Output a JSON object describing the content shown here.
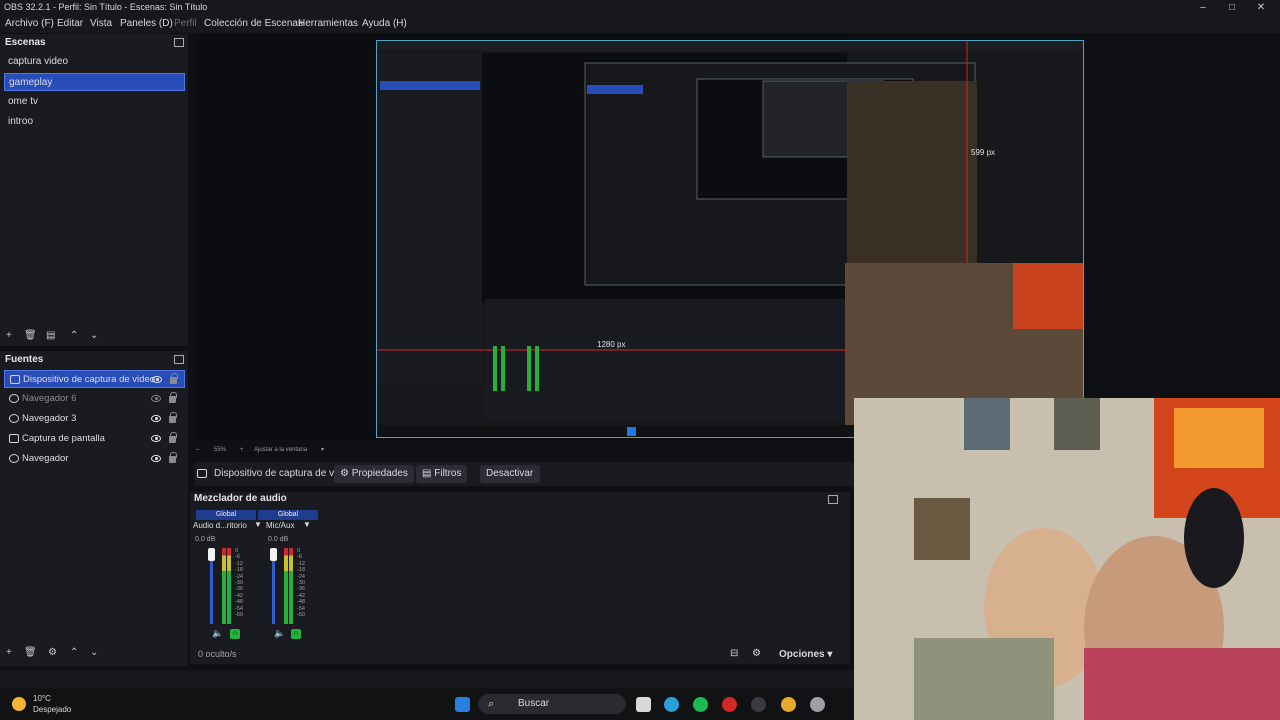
{
  "window": {
    "title": "OBS 32.2.1 - Perfil: Sin Título - Escenas: Sin Título"
  },
  "menu": [
    {
      "label": "Archivo (F)",
      "dim": false
    },
    {
      "label": "Editar",
      "dim": false
    },
    {
      "label": "Vista",
      "dim": false
    },
    {
      "label": "Paneles (D)",
      "dim": false
    },
    {
      "label": "Perfil",
      "dim": true
    },
    {
      "label": "Colección de Escenas",
      "dim": false
    },
    {
      "label": "Herramientas",
      "dim": false
    },
    {
      "label": "Ayuda (H)",
      "dim": false
    }
  ],
  "scenes": {
    "title": "Escenas",
    "items": [
      {
        "label": "captura video",
        "selected": false
      },
      {
        "label": "gameplay",
        "selected": true
      },
      {
        "label": "ome tv",
        "selected": false
      },
      {
        "label": "introo",
        "selected": false
      }
    ]
  },
  "sources": {
    "title": "Fuentes",
    "items": [
      {
        "label": "Dispositivo de captura de video",
        "selected": true,
        "dim": false
      },
      {
        "label": "Navegador 6",
        "selected": false,
        "dim": true
      },
      {
        "label": "Navegador 3",
        "selected": false,
        "dim": false
      },
      {
        "label": "Captura de pantalla",
        "selected": false,
        "dim": false
      },
      {
        "label": "Navegador",
        "selected": false,
        "dim": false
      }
    ]
  },
  "preview": {
    "measure_h": "1280 px",
    "measure_v": "599 px",
    "zoom": "55%",
    "fit": "Ajustar a la ventana"
  },
  "context_bar": {
    "source": "Dispositivo de captura de v",
    "properties": "Propiedades",
    "filters": "Filtros",
    "deactivate": "Desactivar"
  },
  "mixer": {
    "title": "Mezclador de audio",
    "channels": [
      {
        "scope": "Global",
        "name": "Audio d...ritorio",
        "db": "0.0 dB",
        "level": 0.7
      },
      {
        "scope": "Global",
        "name": "Mic/Aux",
        "db": "0.0 dB",
        "level": 0.7
      }
    ],
    "ticks": [
      "0",
      "-6",
      "-12",
      "-18",
      "-24",
      "-30",
      "-36",
      "-42",
      "-48",
      "-54",
      "-60"
    ],
    "hidden": "0 oculto/s",
    "options": "Opciones"
  },
  "taskbar": {
    "weather_temp": "10°C",
    "weather_desc": "Despejado",
    "search": "Buscar"
  },
  "colors": {
    "selected": "#284cb8",
    "border_selected": "#5177e0",
    "meter_green": "#23b23a"
  }
}
